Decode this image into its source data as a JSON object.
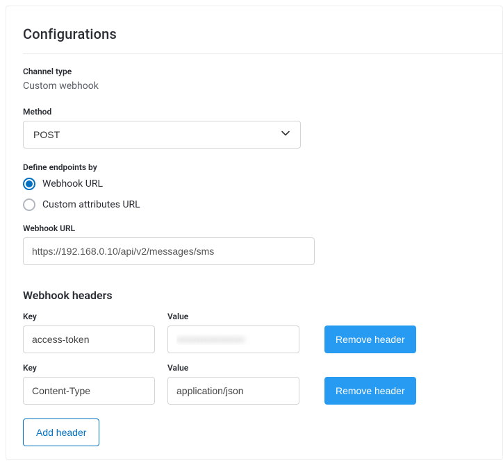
{
  "title": "Configurations",
  "channel_type": {
    "label": "Channel type",
    "value": "Custom webhook"
  },
  "method": {
    "label": "Method",
    "selected": "POST",
    "options": [
      "POST"
    ]
  },
  "endpoint": {
    "label": "Define endpoints by",
    "options": [
      {
        "label": "Webhook URL",
        "selected": true
      },
      {
        "label": "Custom attributes URL",
        "selected": false
      }
    ]
  },
  "webhook_url": {
    "label": "Webhook URL",
    "value": "https://192.168.0.10/api/v2/messages/sms"
  },
  "headers": {
    "title": "Webhook headers",
    "key_label": "Key",
    "value_label": "Value",
    "remove_label": "Remove header",
    "add_label": "Add header",
    "rows": [
      {
        "key": "access-token",
        "value": "••••••••••••••••••••",
        "masked": true
      },
      {
        "key": "Content-Type",
        "value": "application/json",
        "masked": false
      }
    ]
  }
}
